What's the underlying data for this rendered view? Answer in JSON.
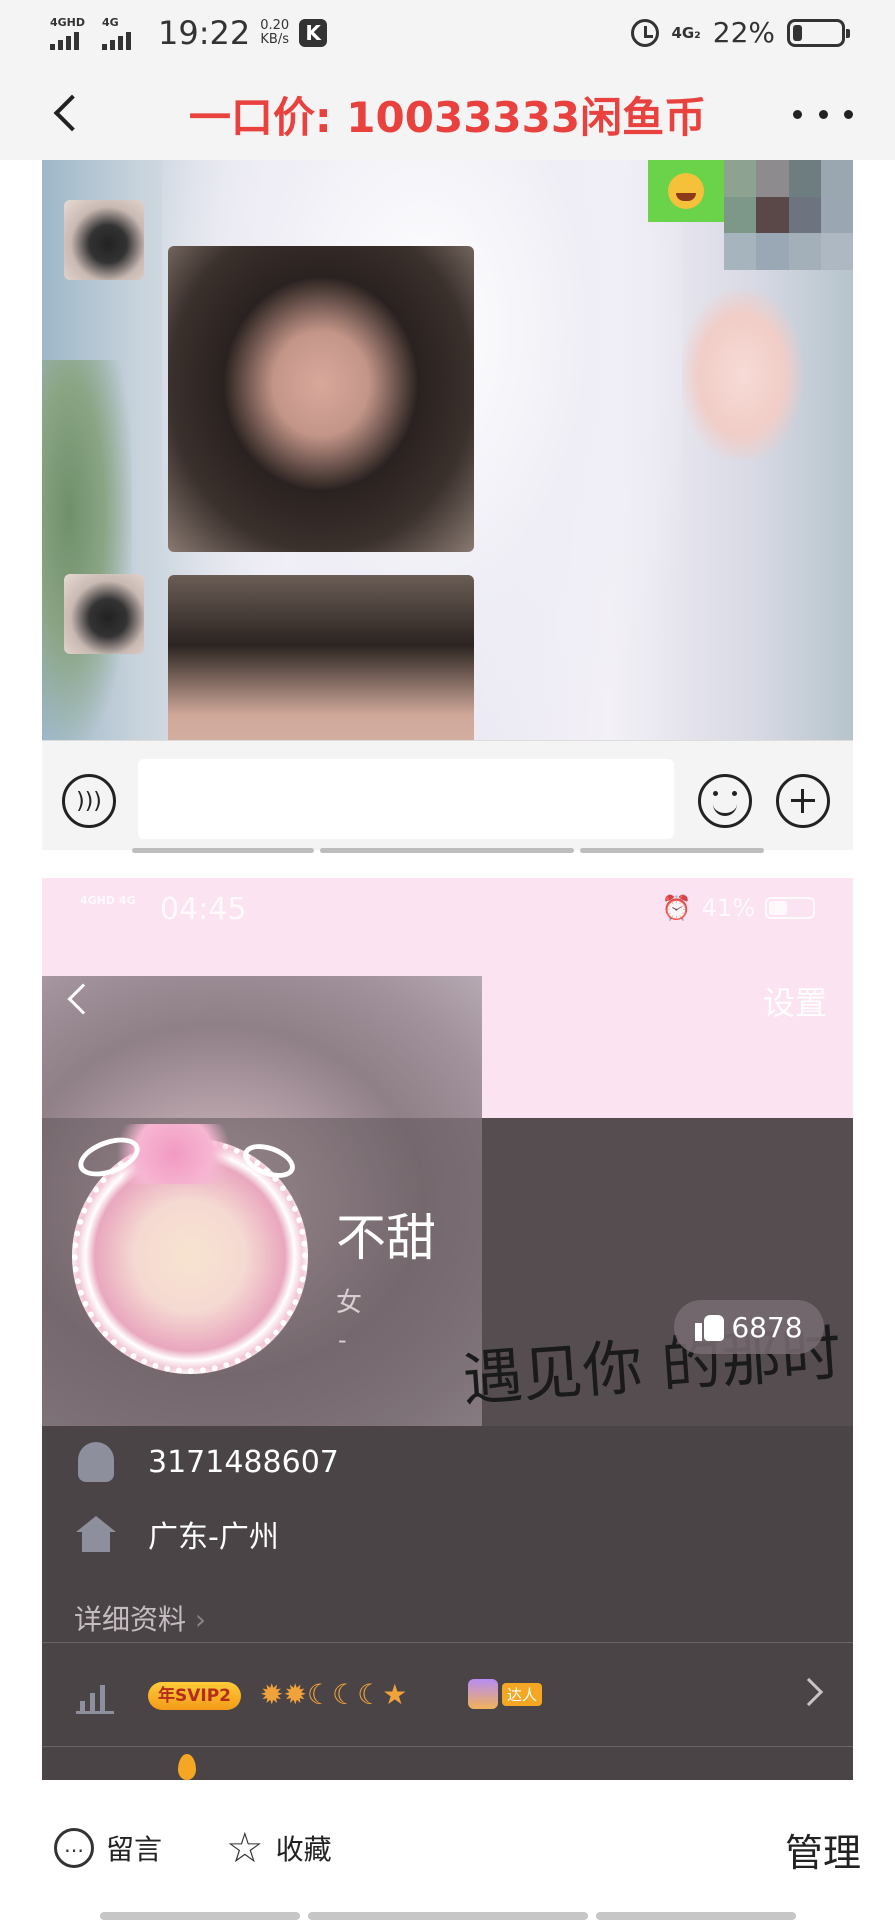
{
  "status_bar": {
    "network_1": "4GHD",
    "network_2": "4G",
    "time": "19:22",
    "speed_value": "0.20",
    "speed_unit": "KB/s",
    "app_badge": "K",
    "network_3": "4G₂",
    "battery": "22%"
  },
  "nav": {
    "title": "一口价: 10033333闲鱼币",
    "back_icon": "chevron-left-icon",
    "more_icon": "more-dots-icon"
  },
  "chat_screenshot": {
    "input_placeholder": ""
  },
  "profile_screenshot": {
    "status_time": "04:45",
    "status_network": "4GHD 4G",
    "status_battery": "41%",
    "settings_label": "设置",
    "nickname": "不甜",
    "gender": "女",
    "extra": "-",
    "likes": "6878",
    "qq_number": "3171488607",
    "location": "广东-广州",
    "detail_link": "详细资料",
    "vip_badge": "年SVIP2",
    "level_icons": "✹✹☾☾☾★",
    "daren_label": "达人",
    "signature_text": "遇见你 的那时"
  },
  "bottom_bar": {
    "comment_label": "留言",
    "favorite_label": "收藏",
    "manage_label": "管理"
  },
  "colors": {
    "title_red": "#e8413e",
    "bar_bg": "#f4f4f4",
    "profile_bg": "#4b4446",
    "pink_header": "#fbe3f1"
  }
}
